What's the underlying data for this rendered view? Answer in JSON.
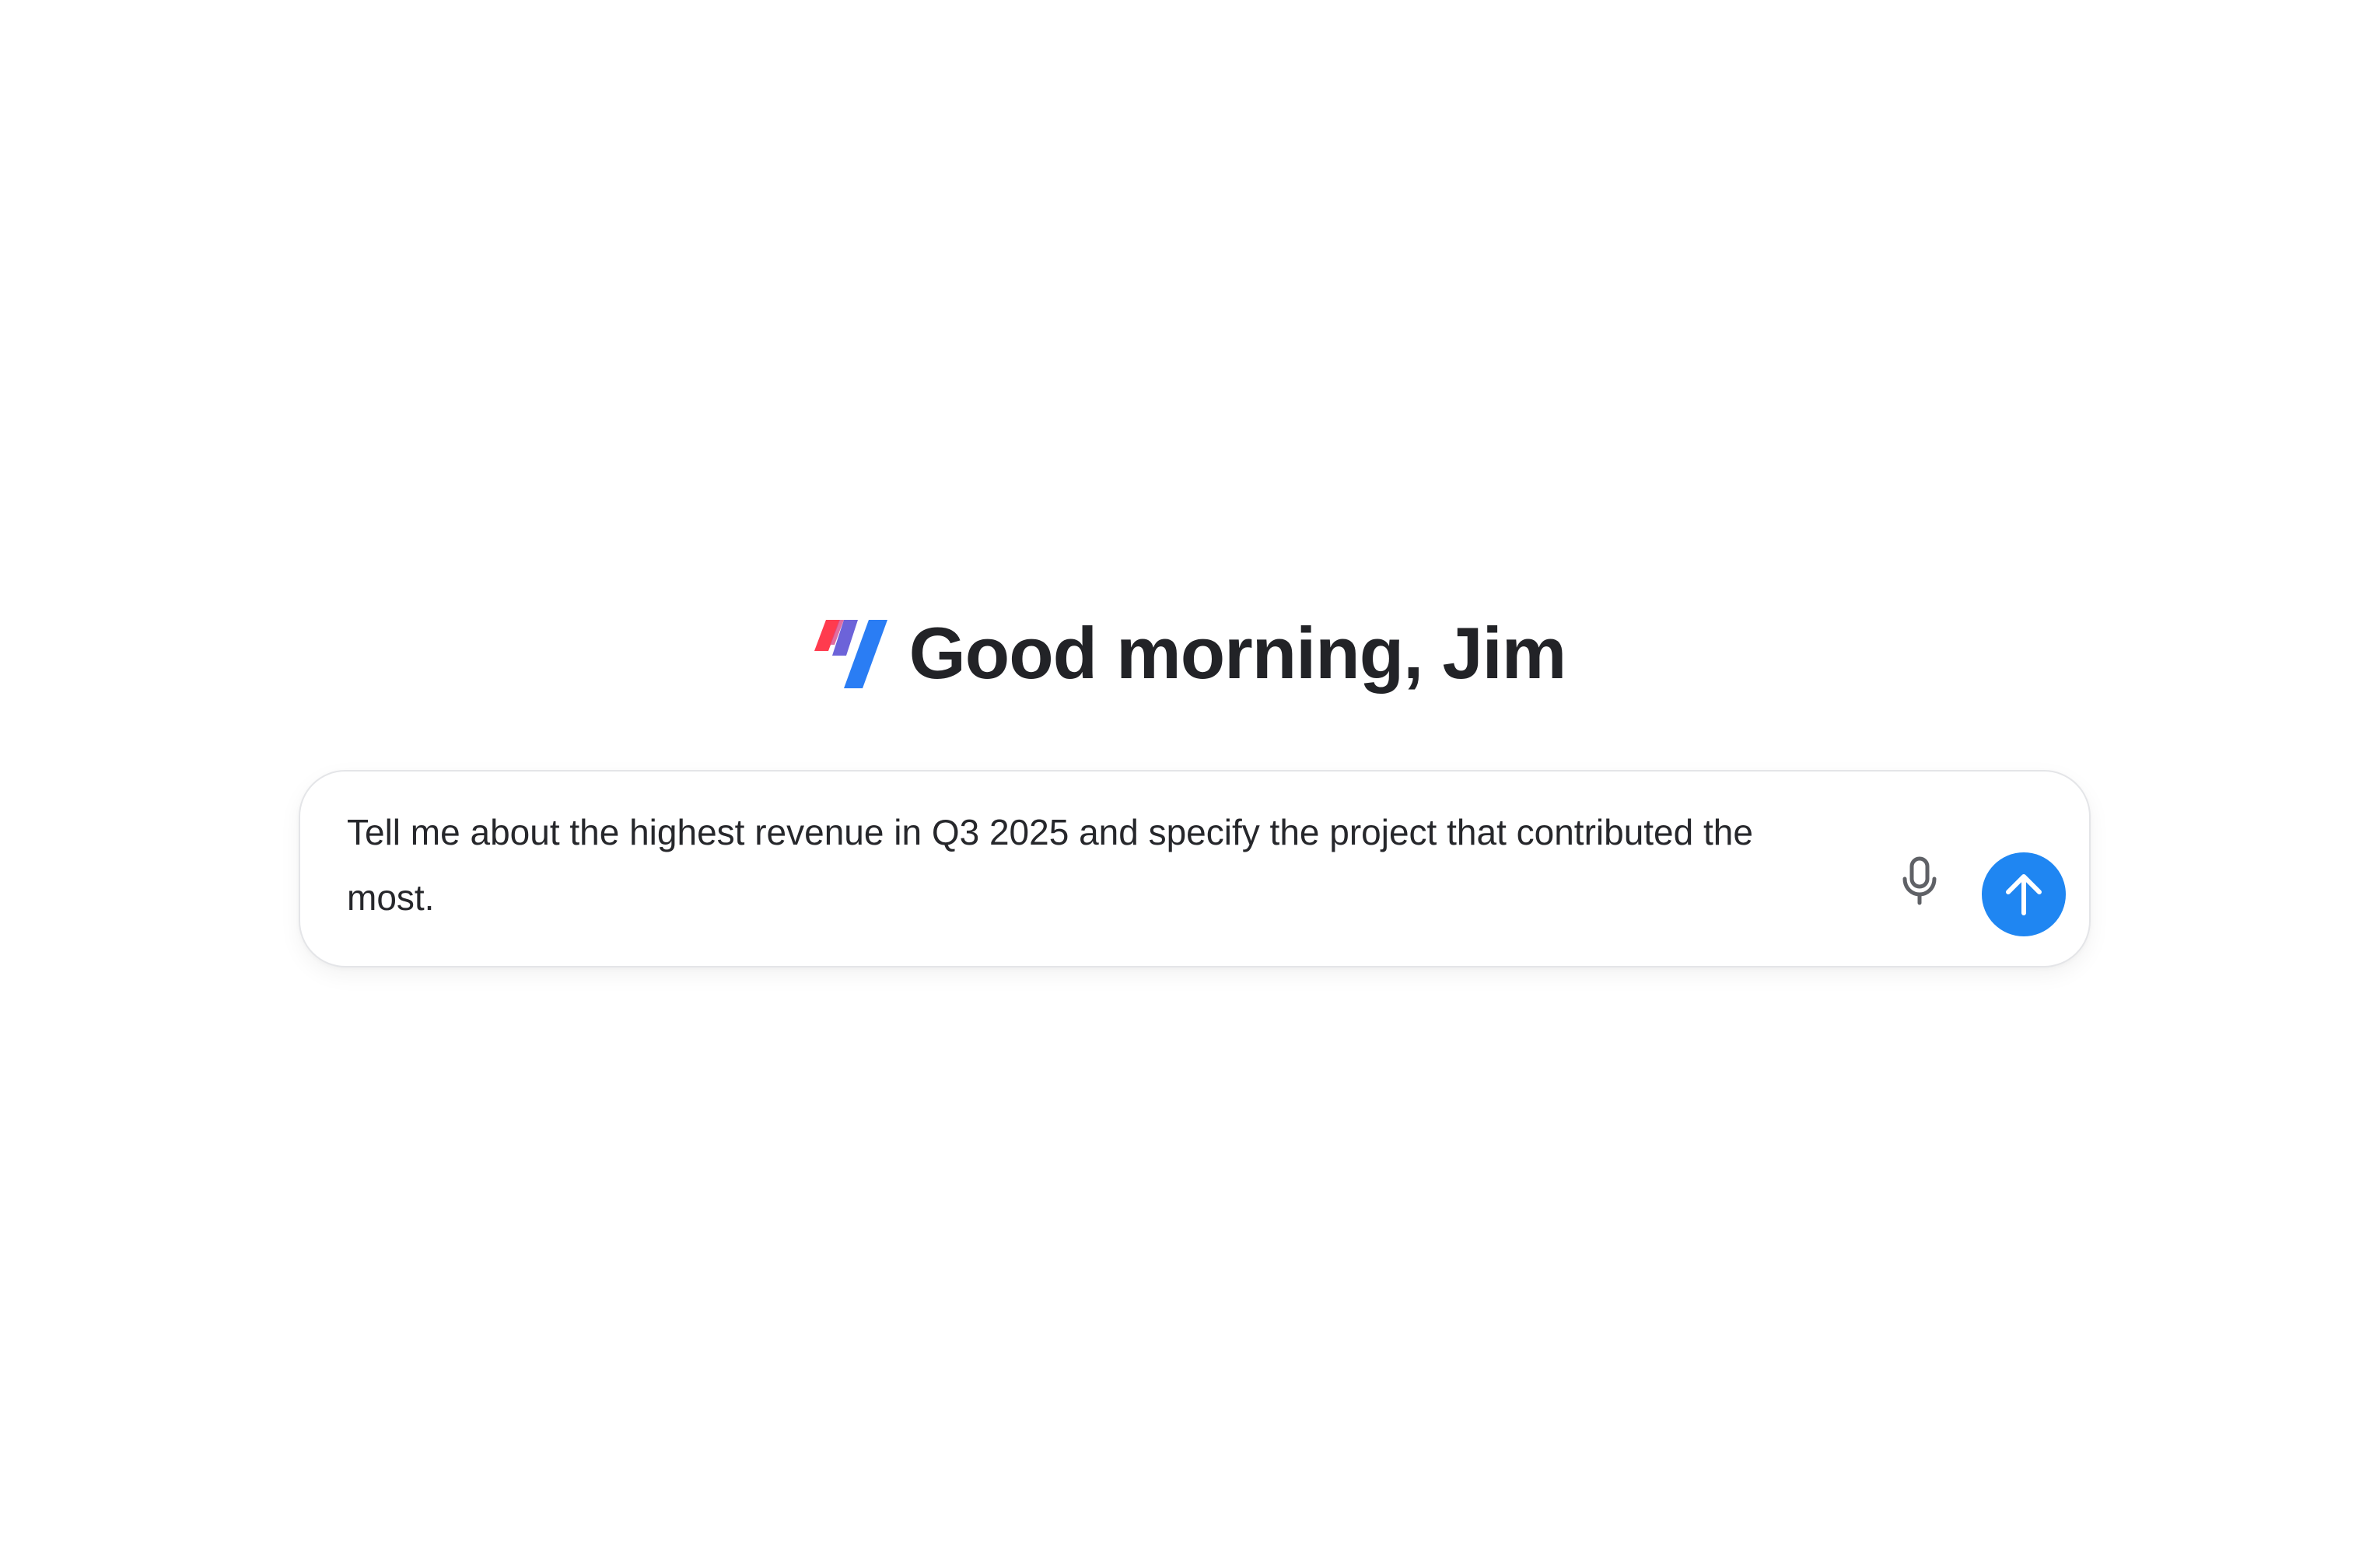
{
  "greeting": {
    "text": "Good morning, Jim",
    "logo_icon": "brand-logo-icon"
  },
  "composer": {
    "input_value": "Tell me about the highest revenue in Q3 2025 and specify the project that contributed the most.",
    "mic_icon": "microphone-icon",
    "send_icon": "arrow-up-icon"
  },
  "colors": {
    "accent": "#1f86f2",
    "logo_red": "#ff3b4e",
    "logo_purple": "#6c63d9",
    "logo_blue": "#2a7df4",
    "text": "#222327"
  }
}
